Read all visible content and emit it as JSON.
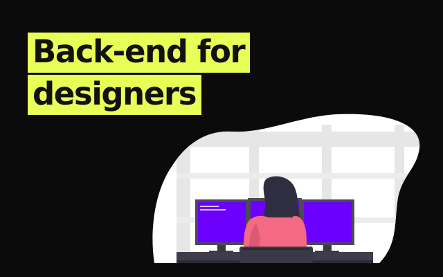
{
  "hero": {
    "title_line_1": "Back-end for",
    "title_line_2": "designers"
  },
  "colors": {
    "background": "#0b0b0b",
    "highlight": "#e8ff57",
    "monitor_screen": "#6c00ff",
    "shirt": "#f46a82",
    "hair": "#2f2e41"
  },
  "illustration": {
    "description_icon": "woman-at-three-monitors-illustration"
  }
}
